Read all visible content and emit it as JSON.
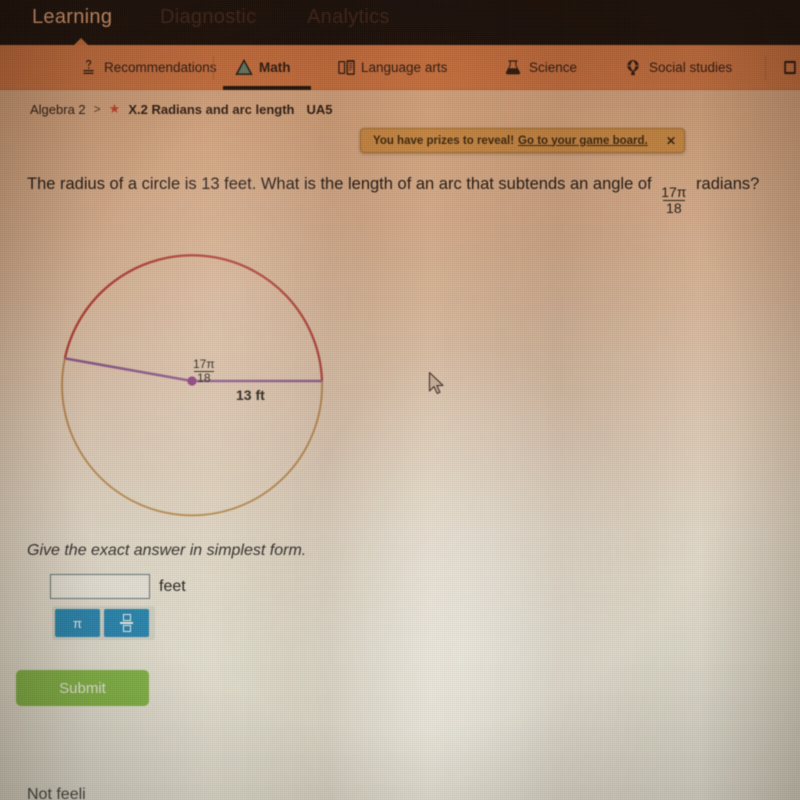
{
  "topbar": {
    "tabs": [
      {
        "label": "Learning",
        "state": "active"
      },
      {
        "label": "Diagnostic",
        "state": "dim"
      },
      {
        "label": "Analytics",
        "state": "dim"
      }
    ]
  },
  "subject_nav": {
    "tabs": [
      {
        "label": "Recommendations",
        "icon": "recommendations-icon",
        "active": false
      },
      {
        "label": "Math",
        "icon": "math-icon",
        "active": true
      },
      {
        "label": "Language arts",
        "icon": "language-arts-icon",
        "active": false
      },
      {
        "label": "Science",
        "icon": "science-icon",
        "active": false
      },
      {
        "label": "Social studies",
        "icon": "social-studies-icon",
        "active": false
      }
    ]
  },
  "breadcrumb": {
    "course": "Algebra 2",
    "separator": ">",
    "star": "★",
    "skill": "X.2 Radians and arc length",
    "code": "UA5"
  },
  "notification": {
    "message": "You have prizes to reveal!",
    "link": "Go to your game board.",
    "close": "✕"
  },
  "question": {
    "part1": "The radius of a circle is 13 feet. What is the length of an arc that subtends an angle of ",
    "angle_numerator": "17π",
    "angle_denominator": "18",
    "part2": " radians?"
  },
  "figure": {
    "angle_numerator": "17π",
    "angle_denominator": "18",
    "radius_label": "13 ft",
    "arc_color": "#c4534f",
    "remainder_color": "#c9a36a",
    "radius_color": "#9b6fb5",
    "center_color": "#9b4fa8"
  },
  "answer": {
    "instruction": "Give the exact answer in simplest form.",
    "input_value": "",
    "input_placeholder": "",
    "unit": "feet"
  },
  "keypad": {
    "pi_label": "π",
    "fraction_label": "□/□"
  },
  "submit": {
    "label": "Submit"
  },
  "footer": {
    "text": "Not feeli"
  },
  "colors": {
    "topbar_bg": "#231a16",
    "subjectnav_bg": "#e2a374",
    "submit_green": "#8cbe4e",
    "keypad_blue": "#2f8fbe",
    "notification_bg": "#e0c077"
  }
}
